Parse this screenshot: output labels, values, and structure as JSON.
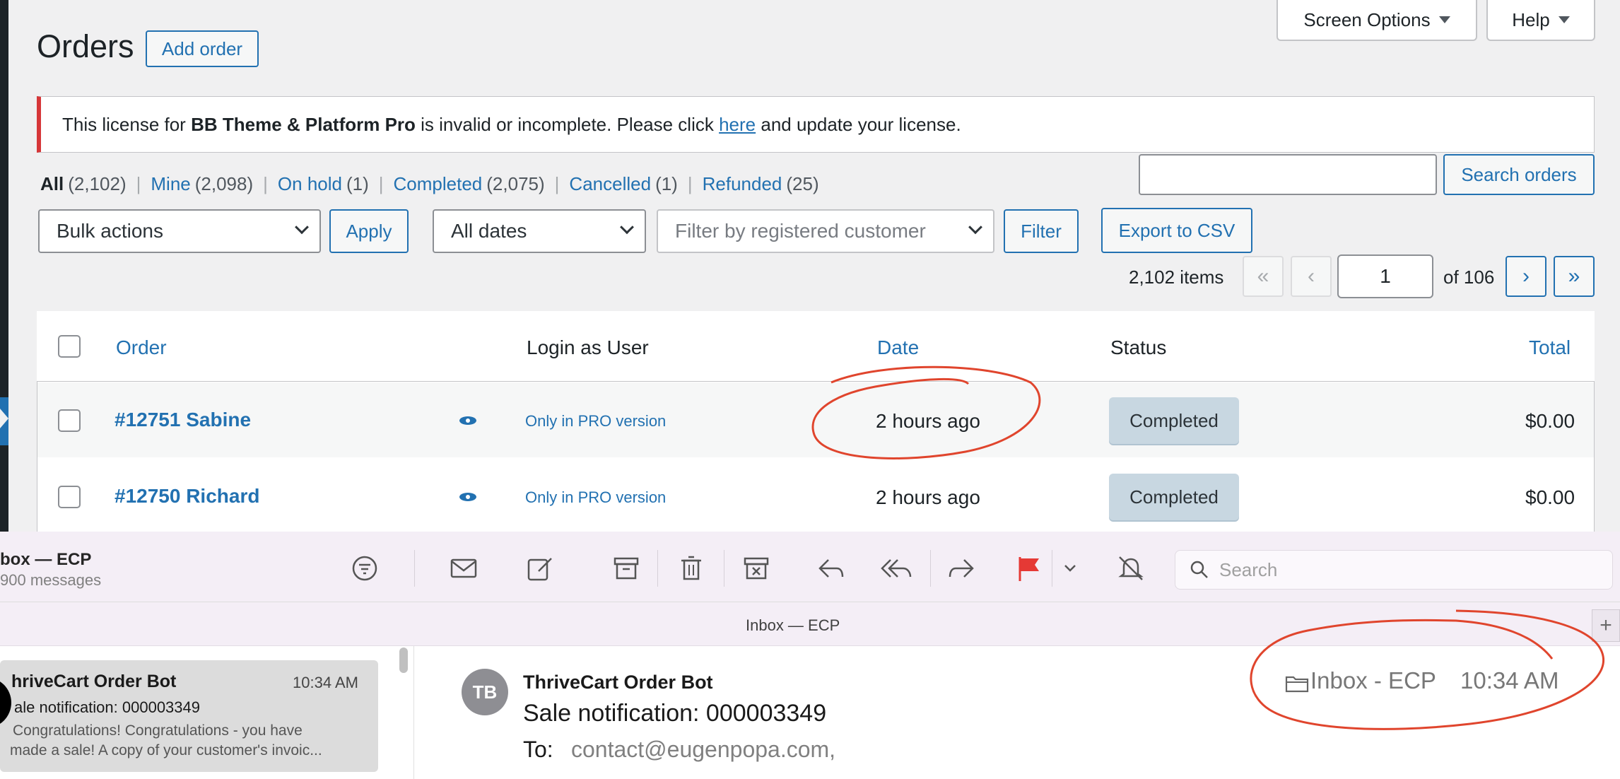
{
  "page": {
    "title": "Orders",
    "add_order": "Add order",
    "screen_options": "Screen Options",
    "help": "Help"
  },
  "notice": {
    "prefix": "This license for ",
    "product": "BB Theme & Platform Pro",
    "middle": " is invalid or incomplete. Please click ",
    "link": "here",
    "suffix": " and update your license."
  },
  "filters": [
    {
      "label": "All",
      "count": "(2,102)"
    },
    {
      "label": "Mine",
      "count": "(2,098)"
    },
    {
      "label": "On hold",
      "count": "(1)"
    },
    {
      "label": "Completed",
      "count": "(2,075)"
    },
    {
      "label": "Cancelled",
      "count": "(1)"
    },
    {
      "label": "Refunded",
      "count": "(25)"
    }
  ],
  "search": {
    "button": "Search orders",
    "value": ""
  },
  "controls": {
    "bulk_actions": "Bulk actions",
    "apply": "Apply",
    "all_dates": "All dates",
    "customer_placeholder": "Filter by registered customer",
    "filter": "Filter",
    "export": "Export to CSV"
  },
  "pagination": {
    "items": "2,102 items",
    "first": "«",
    "prev": "‹",
    "current": "1",
    "of": "of 106",
    "next": "›",
    "last": "»"
  },
  "table": {
    "headers": {
      "order": "Order",
      "login": "Login as User",
      "date": "Date",
      "status": "Status",
      "total": "Total"
    },
    "rows": [
      {
        "order": "#12751 Sabine",
        "login": "Only in PRO version",
        "date": "2 hours ago",
        "status": "Completed",
        "total": "$0.00"
      },
      {
        "order": "#12750 Richard",
        "login": "Only in PRO version",
        "date": "2 hours ago",
        "status": "Completed",
        "total": "$0.00"
      }
    ]
  },
  "mail": {
    "mailbox_title": "box — ECP",
    "mailbox_count": "900 messages",
    "search_placeholder": "Search",
    "header_title": "Inbox — ECP",
    "list_item": {
      "sender": "hriveCart Order Bot",
      "time": "10:34 AM",
      "subject": "ale notification: 000003349",
      "preview1": "Congratulations! Congratulations - you have",
      "preview2": "made a sale! A copy of your customer's invoic..."
    },
    "message": {
      "avatar": "TB",
      "sender": "ThriveCart Order Bot",
      "subject": "Sale notification: 000003349",
      "to_label": "To:",
      "to_value": "contact@eugenpopa.com,",
      "mailbox": "Inbox - ECP",
      "time": "10:34 AM"
    }
  },
  "colors": {
    "accent": "#2271b1",
    "annotation": "#e0452d",
    "flag": "#e53935"
  }
}
